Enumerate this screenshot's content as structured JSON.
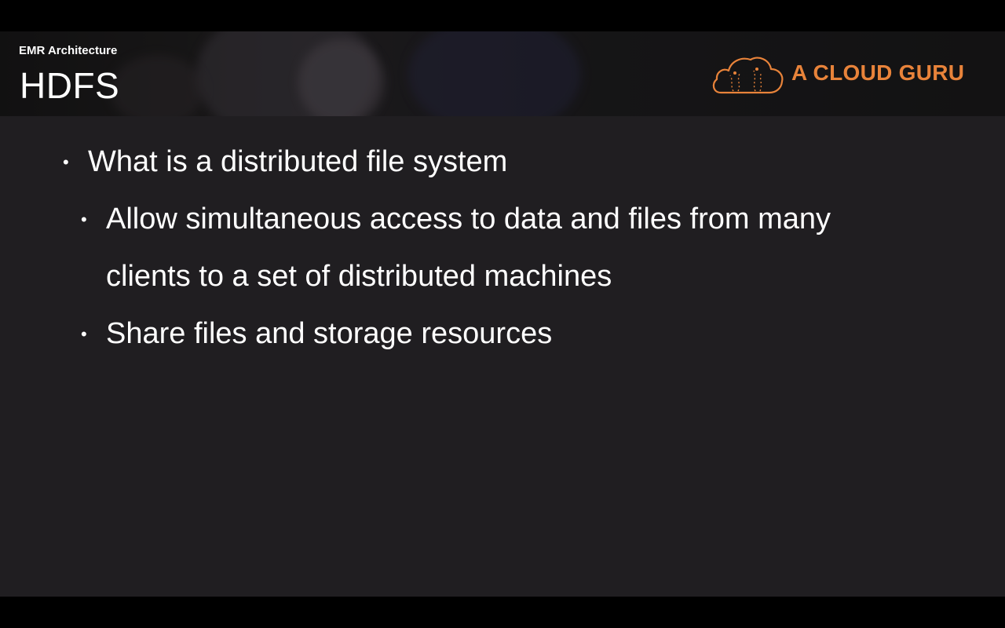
{
  "header": {
    "section_label": "EMR Architecture",
    "title": "HDFS",
    "brand_name": "A CLOUD GURU",
    "brand_icon": "cloud-logo-icon"
  },
  "bullets": [
    {
      "level": 1,
      "marker": "•",
      "lines": [
        "What is a distributed file system"
      ]
    },
    {
      "level": 2,
      "marker": "•",
      "lines": [
        "Allow simultaneous access to data and files from many",
        "clients to a set of distributed machines"
      ]
    },
    {
      "level": 2,
      "marker": "•",
      "lines": [
        "Share files and storage resources"
      ]
    }
  ],
  "colors": {
    "slide_background": "#201e21",
    "text": "#ffffff",
    "brand_accent": "#e8833a",
    "letterbox": "#000000"
  }
}
